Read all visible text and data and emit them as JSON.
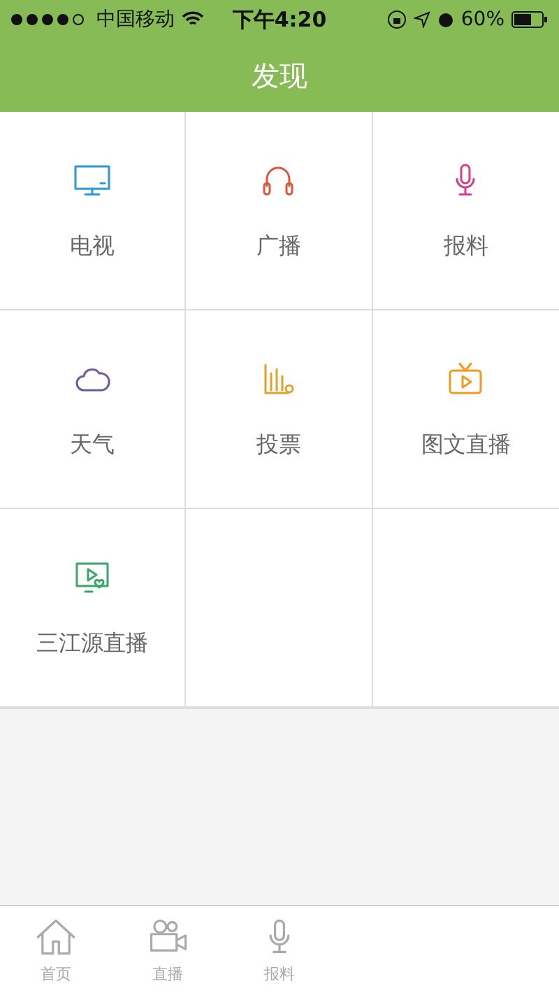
{
  "status_bar": {
    "carrier": "中国移动",
    "time": "下午4:20",
    "battery": "60%"
  },
  "nav_bar": {
    "title": "发现"
  },
  "grid": [
    {
      "label": "电视",
      "kind": "tv",
      "color": "#2a9ad6"
    },
    {
      "label": "广播",
      "kind": "headphones",
      "color": "#d9573a"
    },
    {
      "label": "报料",
      "kind": "mic",
      "color": "#d63d8e"
    },
    {
      "label": "天气",
      "kind": "cloud",
      "color": "#6e5a9c"
    },
    {
      "label": "投票",
      "kind": "chart",
      "color": "#e0a22a"
    },
    {
      "label": "图文直播",
      "kind": "tv-play",
      "color": "#ef9a22"
    },
    {
      "label": "三江源直播",
      "kind": "screen-heart",
      "color": "#3aa56a"
    }
  ],
  "tab_bar": [
    {
      "label": "首页",
      "kind": "home",
      "selected": false
    },
    {
      "label": "直播",
      "kind": "camera",
      "selected": false
    },
    {
      "label": "报料",
      "kind": "mic",
      "selected": false
    }
  ]
}
